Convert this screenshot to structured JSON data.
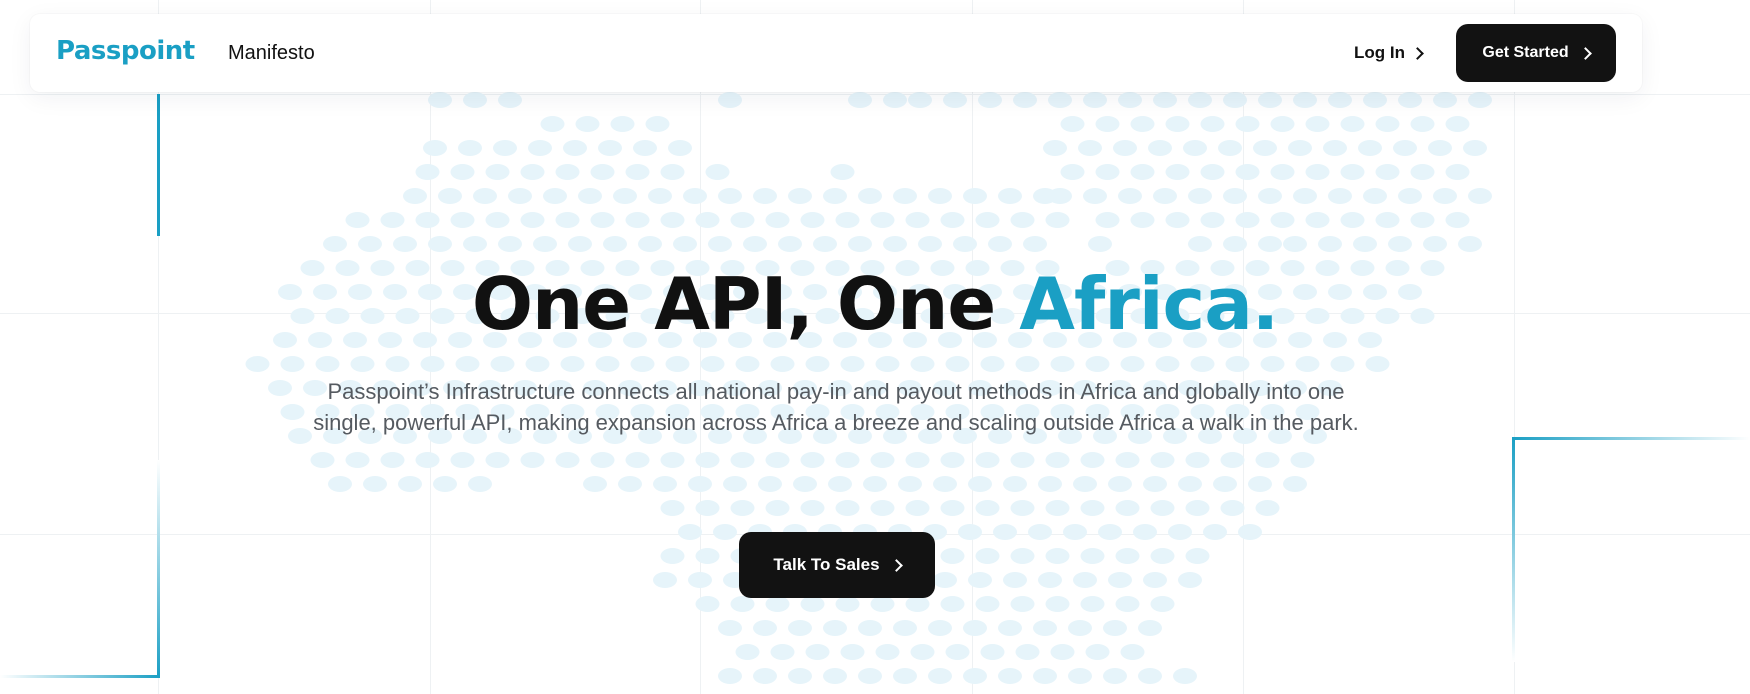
{
  "nav": {
    "logo": "Passpoint",
    "links": [
      "Manifesto"
    ],
    "login_label": "Log In",
    "cta_label": "Get Started"
  },
  "hero": {
    "title_part1": "One API, One ",
    "title_accent": "Africa.",
    "subtitle": "Passpoint’s Infrastructure connects all national pay-in and payout methods in Africa and globally into one single, powerful API, making expansion across Africa a breeze and scaling outside Africa a walk in the park.",
    "button_label": "Talk To Sales"
  },
  "colors": {
    "accent": "#1a9fc4",
    "button": "#121212",
    "dots": "#e6f4fa"
  },
  "icons": [
    "chevron-right-icon"
  ]
}
